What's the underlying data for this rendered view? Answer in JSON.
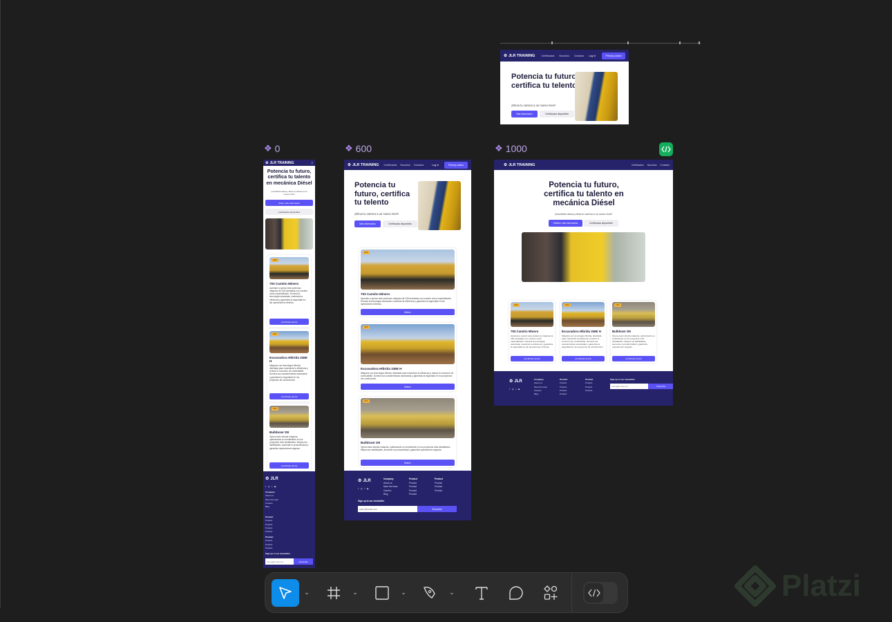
{
  "canvas": {
    "colors": {
      "canvas_bg": "#1e1e1e",
      "navy": "#26236b",
      "primary": "#5b52f5",
      "badge": "#f5b43a",
      "code_badge": "#14ae5c",
      "tool_active": "#0d8ce9"
    }
  },
  "frames": {
    "top": {
      "brand": "JLR TRAINING",
      "nav_links": [
        "Certificados",
        "Nosotros",
        "Contacto"
      ],
      "login": "Log in",
      "primary_action": "Primary action",
      "title": "Potencia tu futuro, certifica tu telento",
      "subtitle": "¡Eleva tu carrera a un nuevo nivel!",
      "btn_primary": "Más información",
      "btn_secondary": "Certificados disponibles"
    },
    "f0": {
      "label": "0",
      "brand": "JLR TRAINING",
      "title": "Potencia tu futuro, certifica tu talento en mecánica Diésel",
      "subtitle": "¡Inscríbete ahora y lleva tu carrera a un nuevo nivel!",
      "btn_primary": "Obtén más información",
      "btn_secondary": "Certificados disponibles"
    },
    "f600": {
      "label": "600",
      "brand": "JLR TRAINING",
      "nav_links": [
        "Certificados",
        "Nosotros",
        "Contacto"
      ],
      "login": "Log in",
      "primary_action": "Primary action",
      "title": "Potencia tu futuro, certifica tu telento",
      "subtitle": "¡Eleva tu carrera a un nuevo nivel!",
      "btn_primary": "Más información",
      "btn_secondary": "Certificados disponibles"
    },
    "f1000": {
      "label": "1000",
      "brand": "JLR TRAINING",
      "nav_links": [
        "Certificados",
        "Nosotros",
        "Contacto"
      ],
      "title": "Potencia tu futuro, certifica tu talento en mecánica Diésel",
      "subtitle": "¡Inscríbete ahora y lleva tu carrera a un nuevo nivel!",
      "btn_primary": "Obtener más información",
      "btn_secondary": "Certificados disponibles"
    }
  },
  "cards": [
    {
      "badge": "NEW",
      "title": "793 Camión Minero",
      "desc": "Aprende a operar este poderoso máquina de 245 toneladas con nuestro curso especializado. Domina la tecnología avanzada, maximiza la eficiencia y garantiza la seguridad en las operaciones mineras.",
      "image": "mining-truck"
    },
    {
      "badge": "NEW",
      "title": "Excavadora Híbrida 336E H",
      "desc": "Máquina con tecnología híbrida, diseñada para maximizar la eficiencia y reducir el consumo de combustible. Domina sus características avanzadas y garantiza la seguridad en los proyectos de construcción.",
      "image": "excavator"
    },
    {
      "badge": "NEW",
      "title": "Bulldozer D9",
      "desc": "Opera esta robusta máquina, optimizando su rendimiento en los proyectos más desafiantes. Mejora tus habilidades, aumenta tu productividad y garantiza operaciones seguras.",
      "image": "bulldozer"
    }
  ],
  "card_buttons": {
    "f0": "¡Certifícate ahora!",
    "f600": "Button",
    "f1000": "¡Certifícate ahora!"
  },
  "footer": {
    "brand": "JLR",
    "socials": [
      "f",
      "◎",
      "t",
      "▶"
    ],
    "columns": [
      {
        "heading": "Company",
        "links": [
          "About us",
          "Meet the team",
          "Careers",
          "Blog"
        ]
      },
      {
        "heading": "Product",
        "links": [
          "Product",
          "Product",
          "Product",
          "Product"
        ]
      },
      {
        "heading": "Product",
        "links": [
          "Product",
          "Product",
          "Product"
        ]
      }
    ],
    "newsletter_label": "Sign up to our newsletter",
    "email_placeholder": "name@email.com",
    "subscribe": "Subscribe"
  },
  "toolbar": {
    "tools": [
      "move-tool",
      "frame-tool",
      "rectangle-tool",
      "pen-tool",
      "text-tool",
      "comment-tool",
      "actions-tool"
    ],
    "active": "move-tool",
    "dev_mode": "off"
  },
  "watermark": "Platzi"
}
